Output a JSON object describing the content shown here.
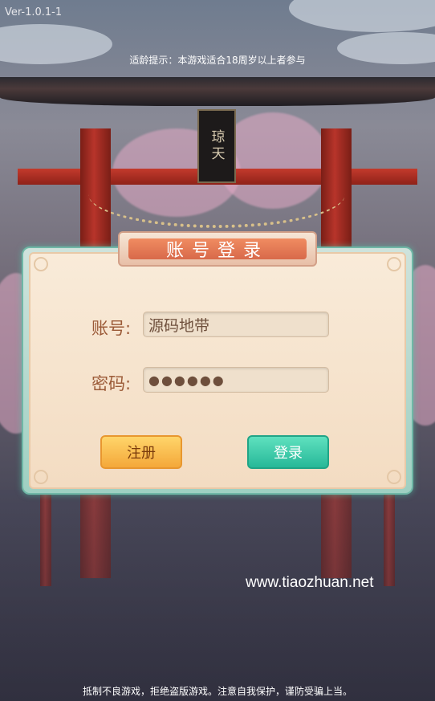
{
  "version": "Ver-1.0.1-1",
  "age_notice": "适龄提示：本游戏适合18周岁以上者参与",
  "plaque_text": "琼天",
  "dialog": {
    "title": "账号登录",
    "account_label": "账号:",
    "account_value": "源码地带",
    "password_label": "密码:",
    "password_value": "●●●●●●",
    "register_label": "注册",
    "login_label": "登录"
  },
  "watermark": "www.tiaozhuan.net",
  "footer_notice": "抵制不良游戏，拒绝盗版游戏。注意自我保护，谨防受骗上当。",
  "colors": {
    "title_bar": "#e07350",
    "register_button": "#f7b444",
    "login_button": "#2fc3a0",
    "label_text": "#9b5a37"
  }
}
